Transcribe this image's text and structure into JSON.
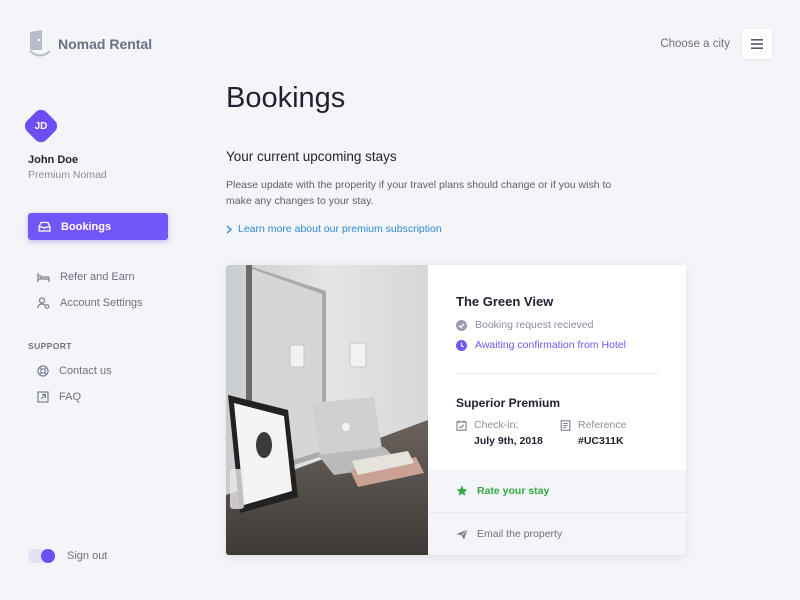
{
  "brand": {
    "name": "Nomad Rental",
    "accent": "#7356f7"
  },
  "header": {
    "city_label": "Choose a city",
    "menu_icon": "hamburger-icon"
  },
  "user": {
    "initials": "JD",
    "name": "John Doe",
    "tier": "Premium Nomad"
  },
  "sidebar": {
    "active_item": {
      "label": "Bookings",
      "icon": "bookings-icon"
    },
    "items": [
      {
        "label": "Refer and Earn",
        "icon": "bed-icon"
      },
      {
        "label": "Account Settings",
        "icon": "user-settings-icon"
      }
    ],
    "support_heading": "SUPPORT",
    "support_items": [
      {
        "label": "Contact us",
        "icon": "lifebuoy-icon"
      },
      {
        "label": "FAQ",
        "icon": "external-link-icon"
      }
    ],
    "signout_label": "Sign out"
  },
  "main": {
    "title": "Bookings",
    "subtitle": "Your current upcoming stays",
    "description": "Please update with the properity if your travel plans should change or if you wish to make any changes to your stay.",
    "premium_link": "Learn more about our premium subscription"
  },
  "booking": {
    "hotel_name": "The Green View",
    "status_1": "Booking request recieved",
    "status_2": "Awaiting confirmation from Hotel",
    "room_type": "Superior Premium",
    "checkin_label": "Check-in:",
    "checkin_value": "July 9th, 2018",
    "reference_label": "Reference",
    "reference_value": "#UC311K",
    "rate_label": "Rate your stay",
    "email_label": "Email the property"
  }
}
